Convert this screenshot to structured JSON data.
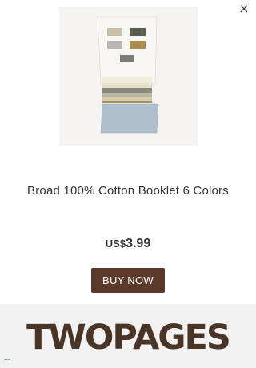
{
  "popup": {
    "close_label": "×",
    "product_image_alt": "fabric swatch booklet",
    "product_title": "Broad 100% Cotton Booklet 6 Colors",
    "price_currency": "US$",
    "price_amount": "3.99",
    "buy_button_label": "BUY NOW",
    "brand_name": "TWOPAGES"
  },
  "colors": {
    "buy_button": "#5b3a29",
    "brand_text": "#4a3426",
    "brand_bar": "#f2f2f2"
  },
  "icons": {
    "close": "close-icon",
    "menu": "menu-icon"
  }
}
